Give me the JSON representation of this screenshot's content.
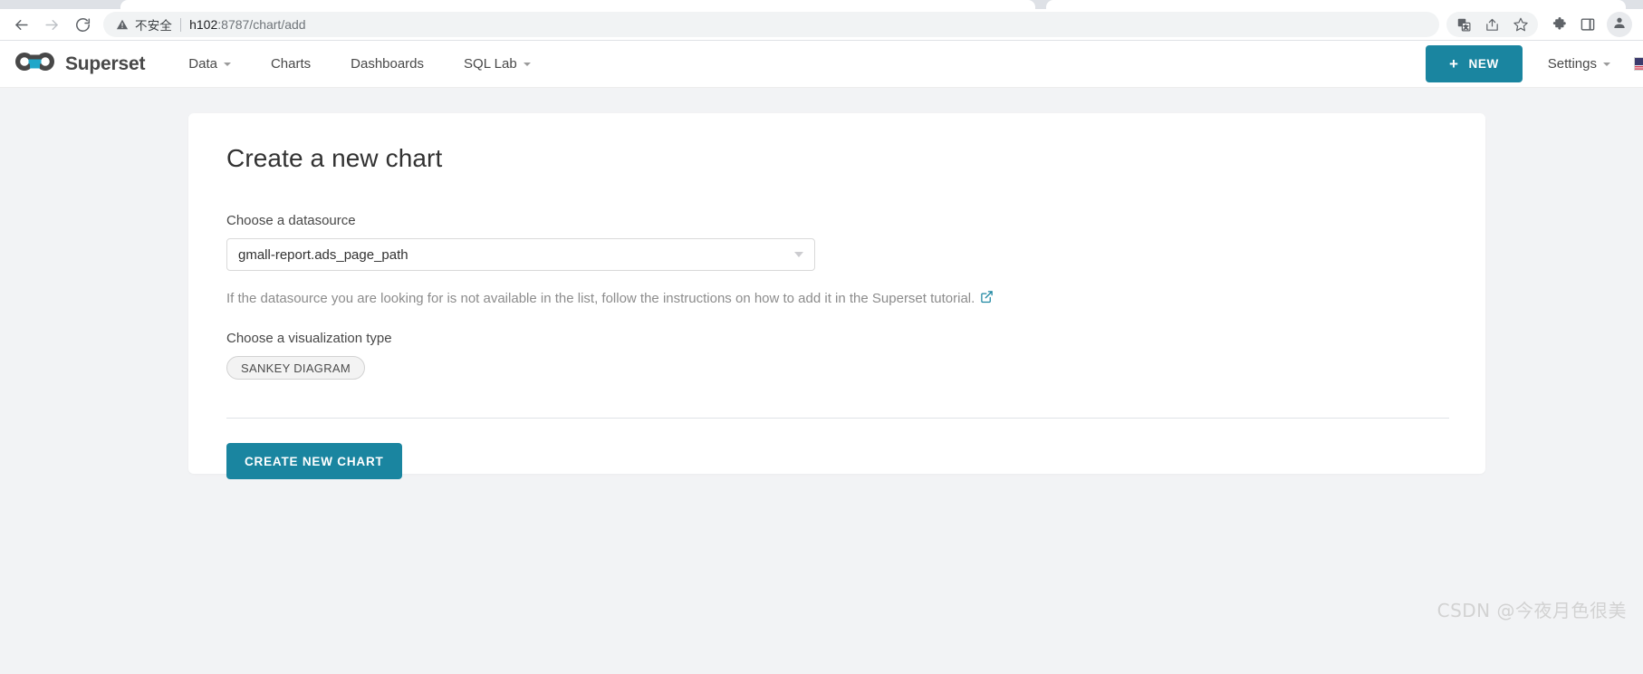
{
  "browser": {
    "back_icon": "arrow-left-icon",
    "forward_icon": "arrow-right-icon",
    "reload_icon": "reload-icon",
    "security_label": "不安全",
    "url_host": "h102",
    "url_path": ":8787/chart/add",
    "toolbar_icons": [
      {
        "name": "translate-icon",
        "title": "翻译"
      },
      {
        "name": "share-icon",
        "title": "分享"
      },
      {
        "name": "bookmark-star-icon",
        "title": "收藏"
      },
      {
        "name": "extensions-puzzle-icon",
        "title": "扩展程序"
      },
      {
        "name": "side-panel-icon",
        "title": "侧边栏"
      },
      {
        "name": "profile-avatar-icon",
        "title": "个人资料"
      }
    ]
  },
  "navbar": {
    "brand": "Superset",
    "brand_logo": "superset-infinity-logo",
    "links": [
      {
        "label": "Data",
        "has_caret": true
      },
      {
        "label": "Charts",
        "has_caret": false
      },
      {
        "label": "Dashboards",
        "has_caret": false
      },
      {
        "label": "SQL Lab",
        "has_caret": true
      }
    ],
    "new_button": {
      "plus": "+",
      "label": "NEW"
    },
    "settings": {
      "label": "Settings",
      "has_caret": true
    },
    "language_flag": "us-flag-icon"
  },
  "main": {
    "title": "Create a new chart",
    "datasource": {
      "label": "Choose a datasource",
      "value": "gmall-report.ads_page_path",
      "caret_icon": "chevron-down-icon"
    },
    "helper": {
      "text": "If the datasource you are looking for is not available in the list, follow the instructions on how to add it in the Superset tutorial.",
      "link_icon": "external-link-icon"
    },
    "visualization": {
      "label": "Choose a visualization type",
      "selected": "SANKEY DIAGRAM"
    },
    "create_button": "CREATE NEW CHART"
  },
  "watermark": "CSDN @今夜月色很美",
  "colors": {
    "accent": "#1a85a0",
    "page_background": "#f2f3f5",
    "card_background": "#ffffff",
    "text_primary": "#323232",
    "text_muted": "#8c8c8c"
  }
}
